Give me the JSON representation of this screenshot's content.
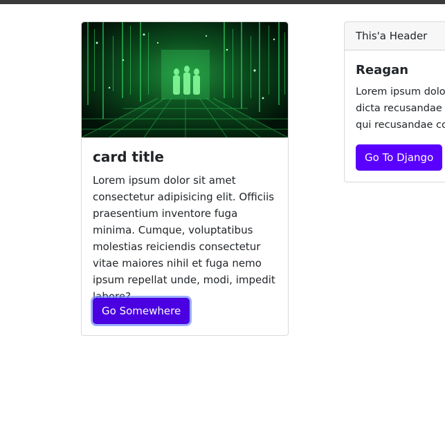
{
  "card1": {
    "title": "card title",
    "text": "Lorem ipsum dolor sit amet consectetur adipisicing elit. Officiis praesentium inventore fuga minima. Cumque, voluptatibus molestias reiciendis consectetur vitae maiores nihil et fuga nemo ipsum repellat unde, modi, impedit labore?",
    "button_label": "Go Somewhere"
  },
  "card2": {
    "header": "This'a Header",
    "title": "Reagan",
    "text_line1": "Lorem ipsum dolo",
    "text_line2": "dicta recusandae i",
    "text_line3": "qui recusandae co",
    "button_label": "Go To Django"
  },
  "colors": {
    "primary": "#5a00ff",
    "primary_focused": "#4a00e0",
    "header_bg": "#f7f7f7"
  }
}
